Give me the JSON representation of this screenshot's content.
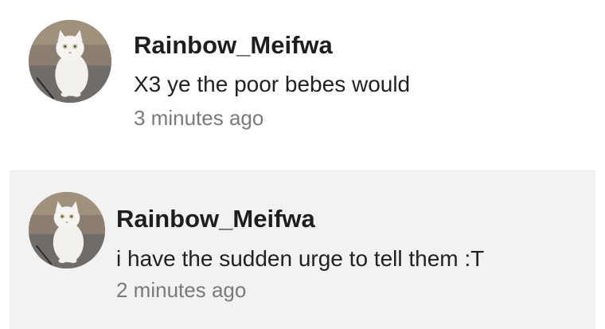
{
  "comments": [
    {
      "username": "Rainbow_Meifwa",
      "message": "X3 ye the poor bebes would",
      "timestamp": "3 minutes ago",
      "avatar": "white-cat-avatar"
    },
    {
      "username": "Rainbow_Meifwa",
      "message": "i have the sudden urge to tell them :T",
      "timestamp": "2 minutes ago",
      "avatar": "white-cat-avatar"
    }
  ],
  "colors": {
    "username": "#1e1e1e",
    "message": "#222222",
    "timestamp": "#7a7a7a",
    "highlight_background": "#f2f2f2"
  }
}
